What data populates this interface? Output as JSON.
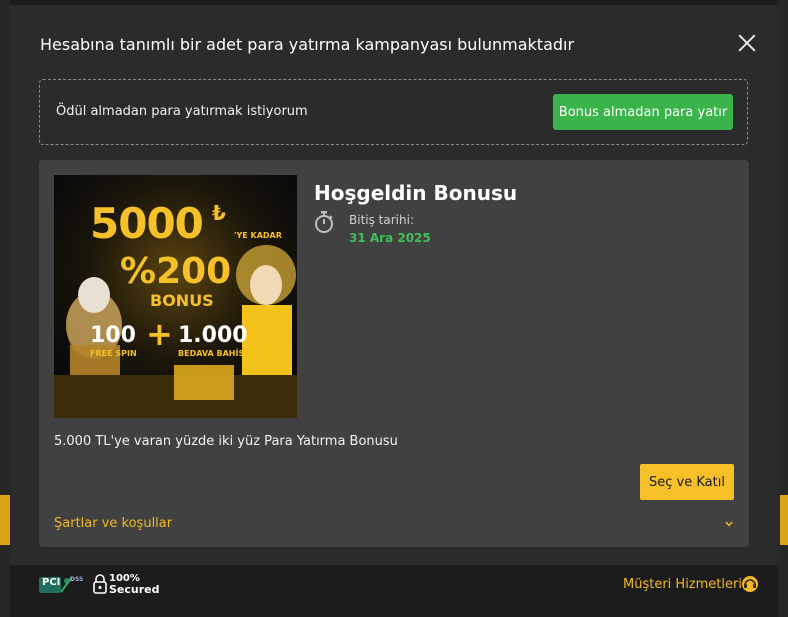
{
  "modal": {
    "title": "Hesabına tanımlı bir adet para yatırma kampanyası bulunmaktadır",
    "no_bonus_text": "Ödül almadan para yatırmak istiyorum",
    "no_bonus_button": "Bonus almadan para yatır"
  },
  "bonus": {
    "name": "Hoşgeldin Bonusu",
    "expiry_label": "Bitiş tarihi:",
    "expiry_date": "31 Ara 2025",
    "description": "5.000 TL'ye varan yüzde iki yüz Para Yatırma Bonusu",
    "join_button": "Seç ve Katıl",
    "terms_link": "Şartlar ve koşullar",
    "image": {
      "amount": "5000",
      "currency": "₺",
      "upto": "'YE KADAR",
      "percent": "%200",
      "bonus_word": "BONUS",
      "spins": "100",
      "spins_label": "FREE SPIN",
      "plus": "+",
      "bets": "1.000",
      "bets_label": "BEDAVA BAHİS"
    }
  },
  "footer": {
    "pci_text": "PCI",
    "pci_dss": "DSS",
    "secured_line1": "100%",
    "secured_line2": "Secured",
    "support_link": "Müşteri Hizmetleri"
  },
  "colors": {
    "accent_yellow": "#f6c028",
    "green": "#3ab34a",
    "expiry_green": "#3fbf55",
    "link_yellow": "#f0b923"
  },
  "icons": [
    "close-icon",
    "stopwatch-icon",
    "chevron-down-icon",
    "pci-dss-logo",
    "lock-icon",
    "headset-icon"
  ]
}
